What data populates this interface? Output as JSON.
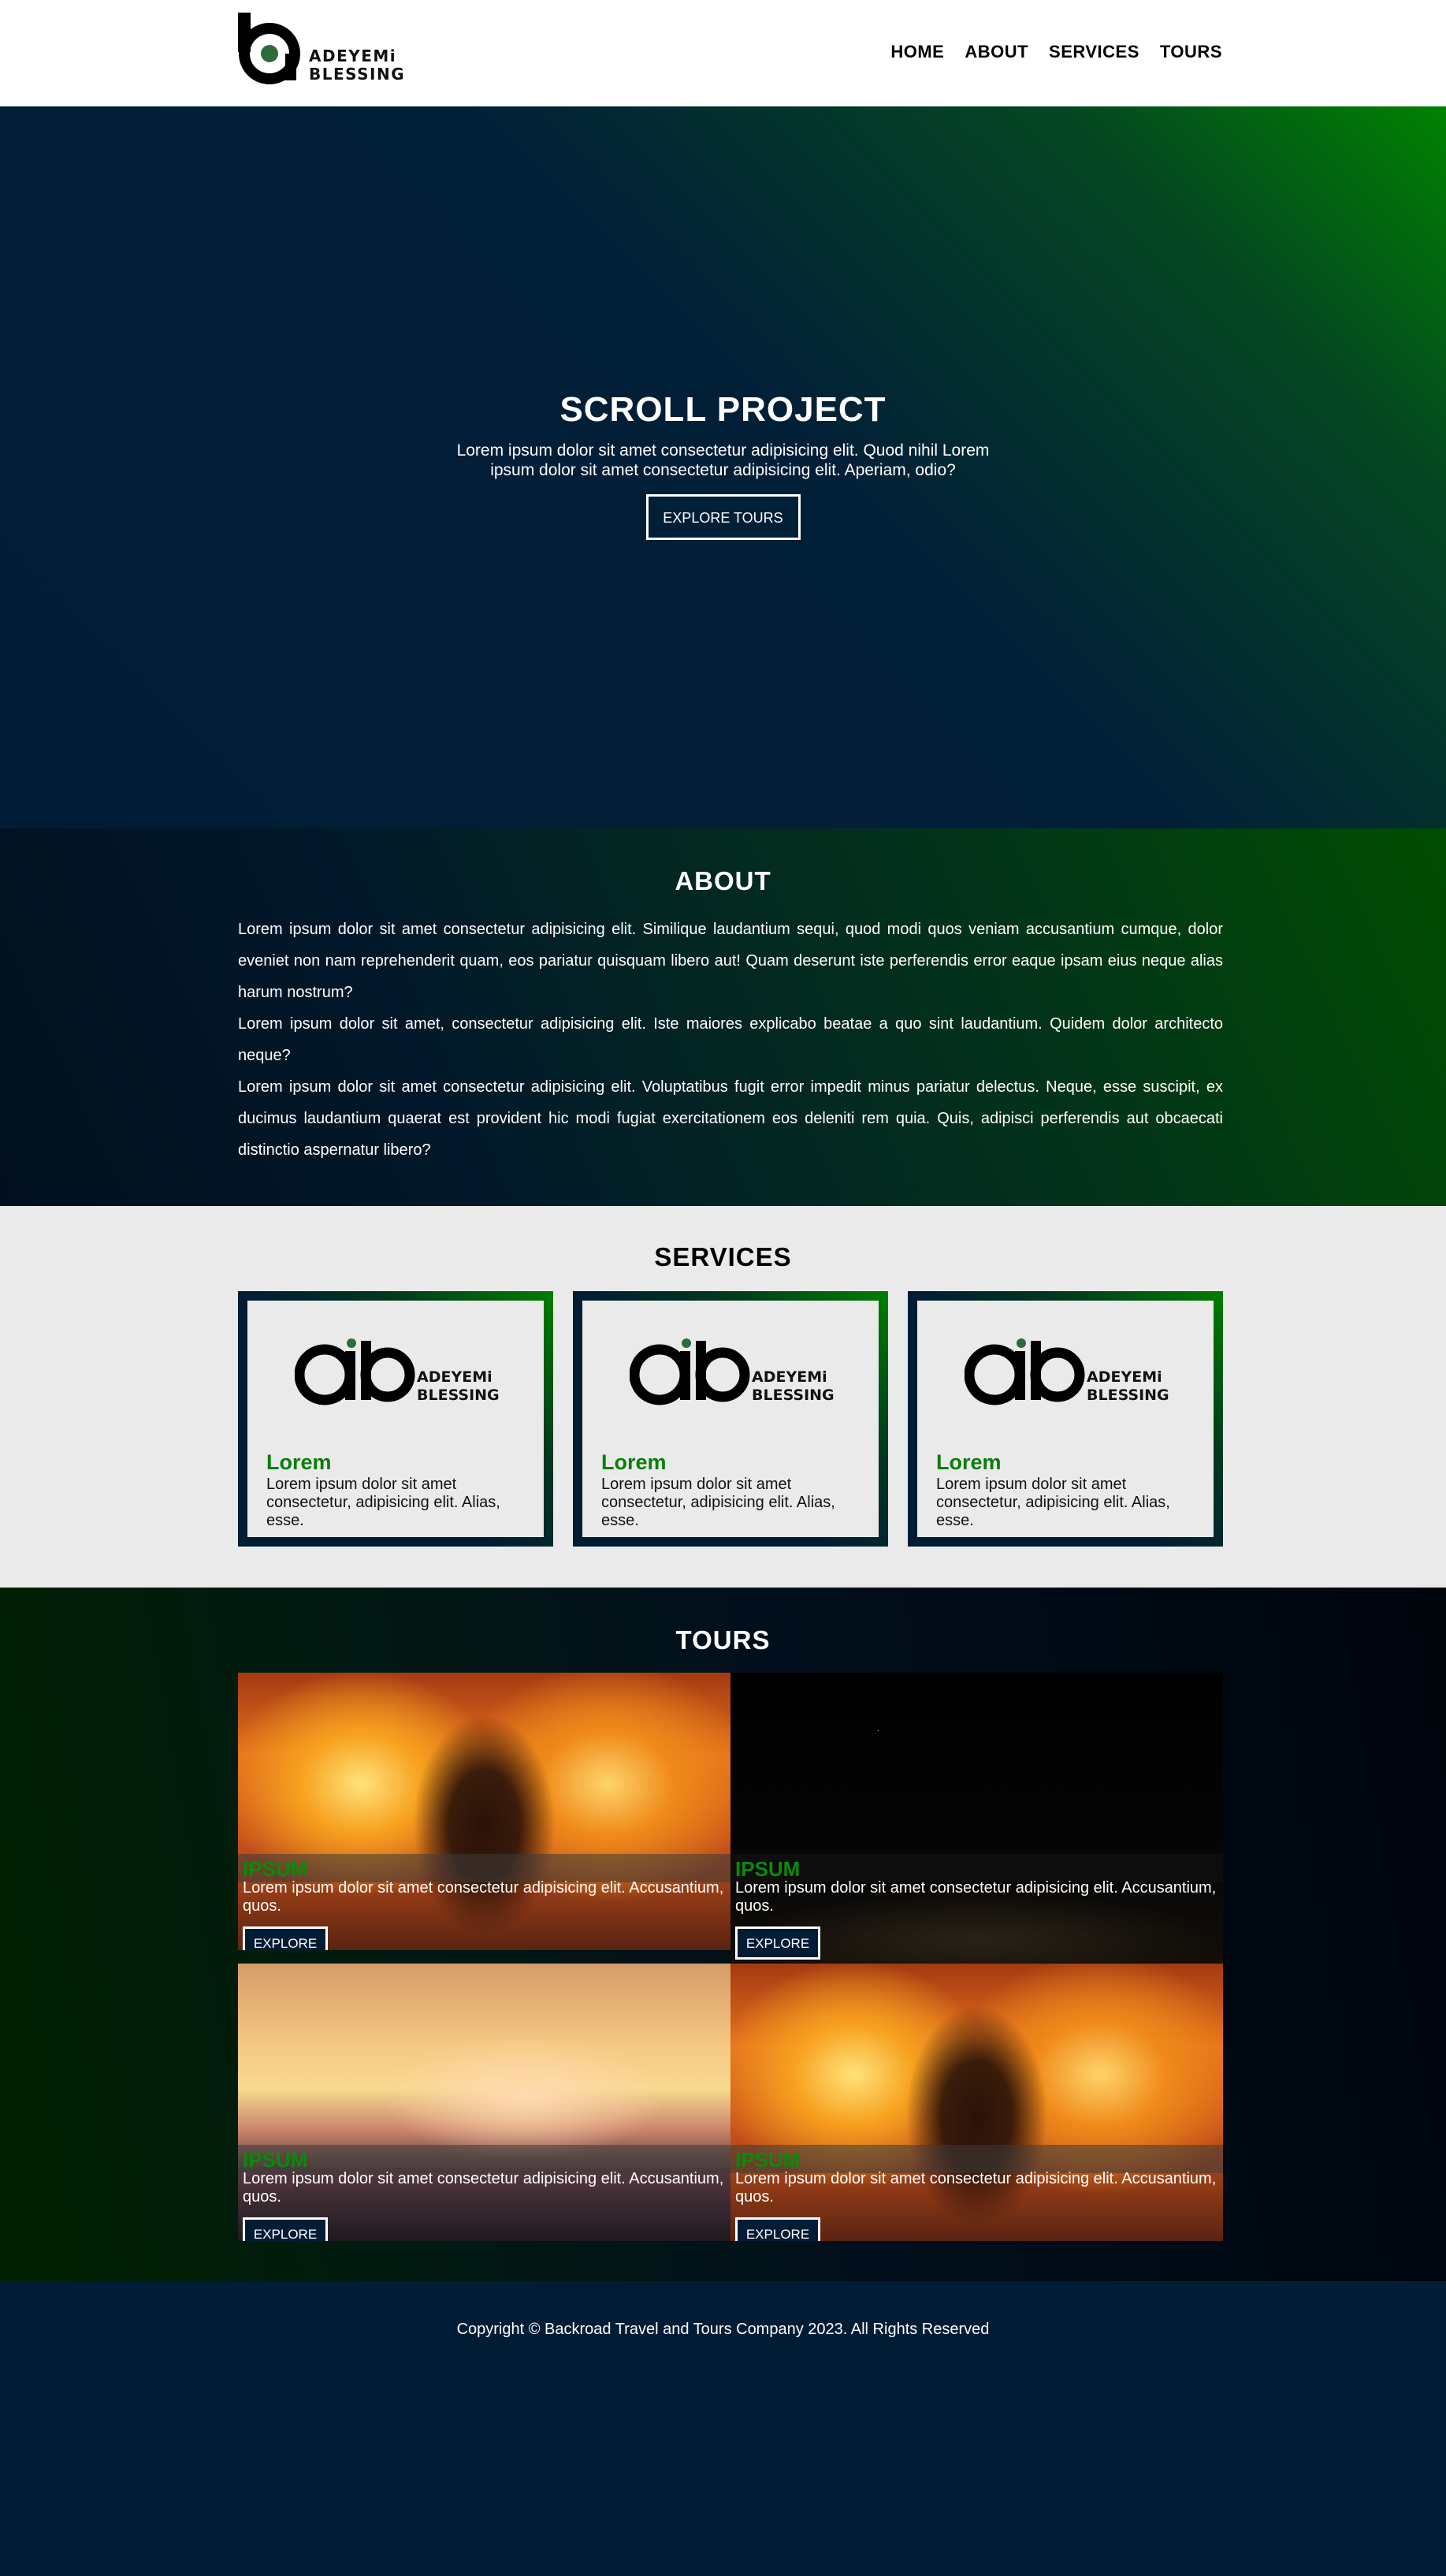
{
  "brand": {
    "line1": "ADEYEMi",
    "line2": "BLESSING"
  },
  "nav": {
    "items": [
      "HOME",
      "ABOUT",
      "SERVICES",
      "TOURS"
    ]
  },
  "hero": {
    "title": "SCROLL PROJECT",
    "text": "Lorem ipsum dolor sit amet consectetur adipisicing elit. Quod nihil Lorem ipsum dolor sit amet consectetur adipisicing elit. Aperiam, odio?",
    "button": "EXPLORE TOURS"
  },
  "about": {
    "title": "ABOUT",
    "paragraphs": [
      "Lorem ipsum dolor sit amet consectetur adipisicing elit. Similique laudantium sequi, quod modi quos veniam accusantium cumque, dolor eveniet non nam reprehenderit quam, eos pariatur quisquam libero aut! Quam deserunt iste perferendis error eaque ipsam eius neque alias harum nostrum?",
      "Lorem ipsum dolor sit amet, consectetur adipisicing elit. Iste maiores explicabo beatae a quo sint laudantium. Quidem dolor architecto neque?",
      "Lorem ipsum dolor sit amet consectetur adipisicing elit. Voluptatibus fugit error impedit minus pariatur delectus. Neque, esse suscipit, ex ducimus laudantium quaerat est provident hic modi fugiat exercitationem eos deleniti rem quia. Quis, adipisci perferendis aut obcaecati distinctio aspernatur libero?"
    ]
  },
  "services": {
    "title": "SERVICES",
    "cards": [
      {
        "title": "Lorem",
        "text": "Lorem ipsum dolor sit amet consectetur, adipisicing elit. Alias, esse."
      },
      {
        "title": "Lorem",
        "text": "Lorem ipsum dolor sit amet consectetur, adipisicing elit. Alias, esse."
      },
      {
        "title": "Lorem",
        "text": "Lorem ipsum dolor sit amet consectetur, adipisicing elit. Alias, esse."
      }
    ]
  },
  "tours": {
    "title": "TOURS",
    "items": [
      {
        "name": "IPSUM",
        "text": "Lorem ipsum dolor sit amet consectetur adipisicing elit. Accusantium, quos.",
        "button": "EXPLORE"
      },
      {
        "name": "IPSUM",
        "text": "Lorem ipsum dolor sit amet consectetur adipisicing elit. Accusantium, quos.",
        "button": "EXPLORE"
      },
      {
        "name": "IPSUM",
        "text": "Lorem ipsum dolor sit amet consectetur adipisicing elit. Accusantium, quos.",
        "button": "EXPLORE"
      },
      {
        "name": "IPSUM",
        "text": "Lorem ipsum dolor sit amet consectetur adipisicing elit. Accusantium, quos.",
        "button": "EXPLORE"
      }
    ]
  },
  "footer": {
    "copyright": "Copyright © Backroad Travel and Tours Company 2023. All Rights Reserved"
  },
  "colors": {
    "navy": "#011d36",
    "green": "#008200",
    "accent_text": "#0a8a0a",
    "light_bg": "#eaeaea"
  }
}
